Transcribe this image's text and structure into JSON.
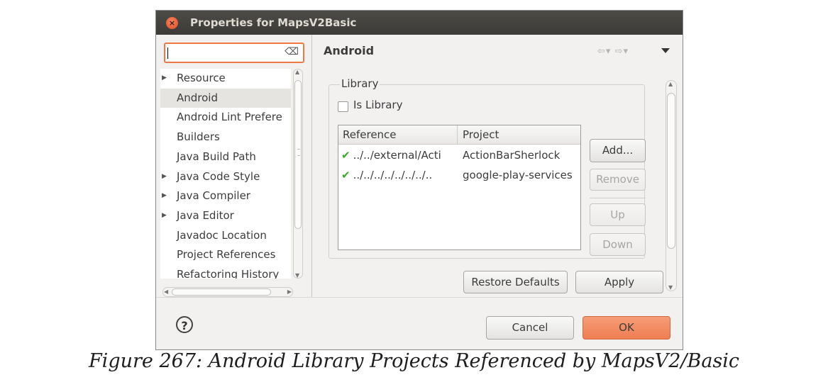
{
  "window": {
    "title": "Properties for MapsV2Basic"
  },
  "filter": {
    "value": "",
    "clear_icon": "clear-text-icon"
  },
  "tree": {
    "items": [
      {
        "label": "Resource",
        "expandable": true,
        "selected": false
      },
      {
        "label": "Android",
        "expandable": false,
        "selected": true
      },
      {
        "label": "Android Lint Prefere",
        "expandable": false,
        "selected": false
      },
      {
        "label": "Builders",
        "expandable": false,
        "selected": false
      },
      {
        "label": "Java Build Path",
        "expandable": false,
        "selected": false
      },
      {
        "label": "Java Code Style",
        "expandable": true,
        "selected": false
      },
      {
        "label": "Java Compiler",
        "expandable": true,
        "selected": false
      },
      {
        "label": "Java Editor",
        "expandable": true,
        "selected": false
      },
      {
        "label": "Javadoc Location",
        "expandable": false,
        "selected": false
      },
      {
        "label": "Project References",
        "expandable": false,
        "selected": false
      },
      {
        "label": "Refactoring History",
        "expandable": false,
        "selected": false
      }
    ]
  },
  "page": {
    "title": "Android",
    "library_group": "Library",
    "is_library": {
      "label": "Is Library",
      "checked": false
    },
    "table": {
      "columns": [
        "Reference",
        "Project"
      ],
      "rows": [
        {
          "reference": "../../external/Acti",
          "project": "ActionBarSherlock"
        },
        {
          "reference": "../../../../../../../..",
          "project": "google-play-services"
        }
      ]
    },
    "buttons": {
      "add": "Add...",
      "remove": "Remove",
      "up": "Up",
      "down": "Down"
    },
    "restore_defaults": "Restore Defaults",
    "apply": "Apply"
  },
  "footer": {
    "cancel": "Cancel",
    "ok": "OK"
  },
  "caption": "Figure 267: Android Library Projects Referenced by MapsV2/Basic",
  "colors": {
    "accent": "#f07746",
    "ok_button": "#ef7e52",
    "titlebar": "#3c3b37",
    "check": "#3ba82d"
  }
}
